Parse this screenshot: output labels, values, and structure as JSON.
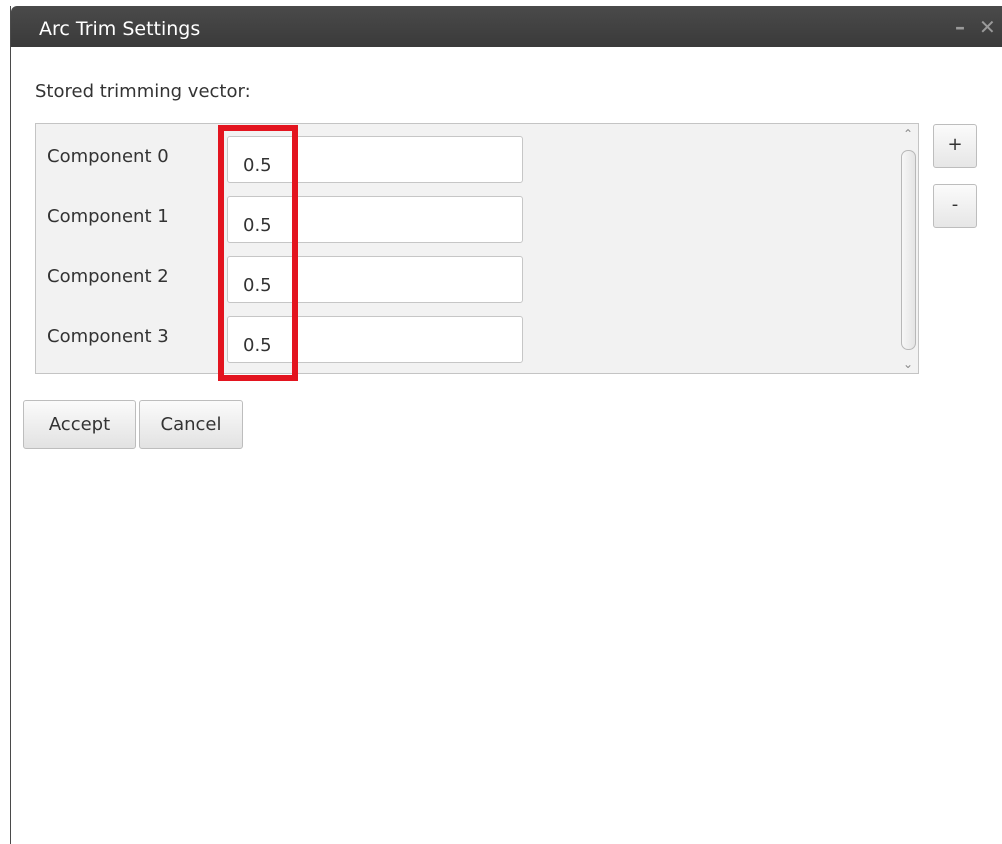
{
  "window": {
    "title": "Arc Trim Settings",
    "minimize_label": "–",
    "close_label": "✕"
  },
  "stored_label": "Stored trimming vector:",
  "components": [
    {
      "label": "Component 0",
      "value": "0.5"
    },
    {
      "label": "Component 1",
      "value": "0.5"
    },
    {
      "label": "Component 2",
      "value": "0.5"
    },
    {
      "label": "Component 3",
      "value": "0.5"
    }
  ],
  "side_buttons": {
    "add_label": "+",
    "remove_label": "-"
  },
  "scrollbar": {
    "up_icon": "⌃",
    "down_icon": "⌄"
  },
  "buttons": {
    "accept_label": "Accept",
    "cancel_label": "Cancel"
  },
  "colors": {
    "highlight": "#e3141f",
    "titlebar": "#3f3f3f"
  }
}
